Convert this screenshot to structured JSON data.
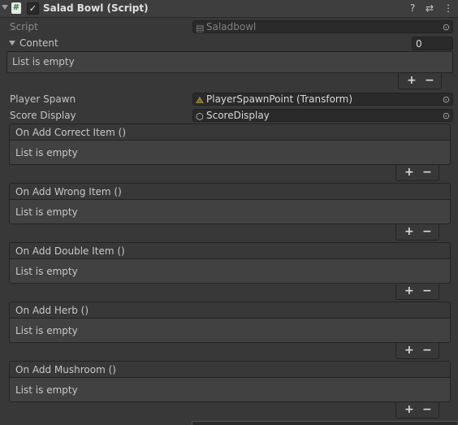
{
  "component": {
    "title": "Salad Bowl (Script)",
    "enabled": true,
    "icons": [
      "help-icon",
      "preset-icon",
      "kebab-menu-icon"
    ]
  },
  "script_field": {
    "label": "Script",
    "value": "Saladbowl"
  },
  "content": {
    "label": "Content",
    "count": "0",
    "empty_text": "List is empty"
  },
  "player_spawn": {
    "label": "Player Spawn",
    "value": "PlayerSpawnPoint (Transform)"
  },
  "score_display": {
    "label": "Score Display",
    "value": "ScoreDisplay"
  },
  "events": [
    {
      "label": "On Add Correct Item ()",
      "empty_text": "List is empty"
    },
    {
      "label": "On Add Wrong Item ()",
      "empty_text": "List is empty"
    },
    {
      "label": "On Add Double Item ()",
      "empty_text": "List is empty"
    },
    {
      "label": "On Add Herb ()",
      "empty_text": "List is empty"
    },
    {
      "label": "On Add Mushroom ()",
      "empty_text": "List is empty"
    }
  ],
  "list_buttons": {
    "add": "+",
    "remove": "−"
  },
  "glyphs": {
    "check": "✓",
    "help": "?",
    "preset": "⇄",
    "menu": "⋮",
    "hash": "#",
    "picker": "⊙",
    "cube": "⬡",
    "transform": "⟁",
    "doc": "▤"
  }
}
